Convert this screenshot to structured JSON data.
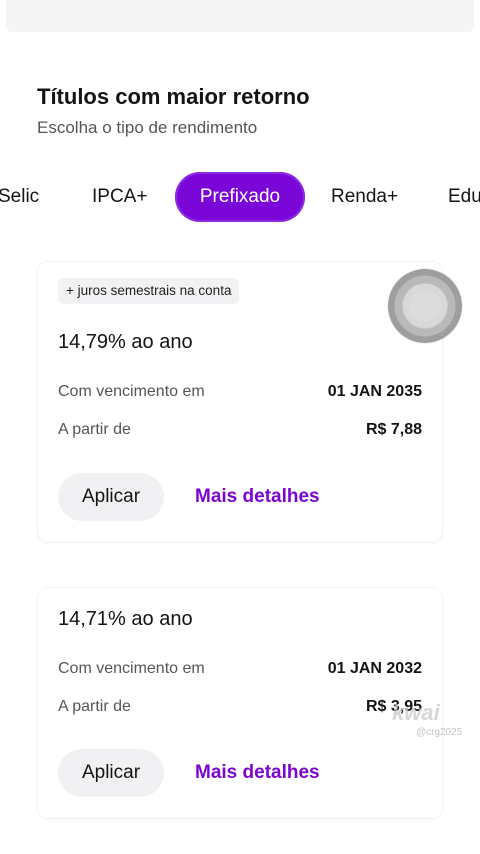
{
  "section": {
    "title": "Títulos com maior retorno",
    "subtitle": "Escolha o tipo de rendimento"
  },
  "tabs": [
    "Selic",
    "IPCA+",
    "Prefixado",
    "Renda+",
    "Edu"
  ],
  "selected_tab": "Prefixado",
  "cards": [
    {
      "badge": "+ juros semestrais na conta",
      "rate": "14,79% ao ano",
      "maturity_label": "Com vencimento em",
      "maturity_value": "01 JAN 2035",
      "price_label": "A partir de",
      "price_value": "R$ 7,88",
      "apply_label": "Aplicar",
      "details_label": "Mais detalhes"
    },
    {
      "rate": "14,71% ao ano",
      "maturity_label": "Com vencimento em",
      "maturity_value": "01 JAN 2032",
      "price_label": "A partir de",
      "price_value": "R$ 3,95",
      "apply_label": "Aplicar",
      "details_label": "Mais detalhes"
    }
  ],
  "watermark": {
    "brand": "kwai",
    "handle": "@crg2025"
  },
  "colors": {
    "accent": "#7b06d8",
    "link": "#7a06cf"
  }
}
